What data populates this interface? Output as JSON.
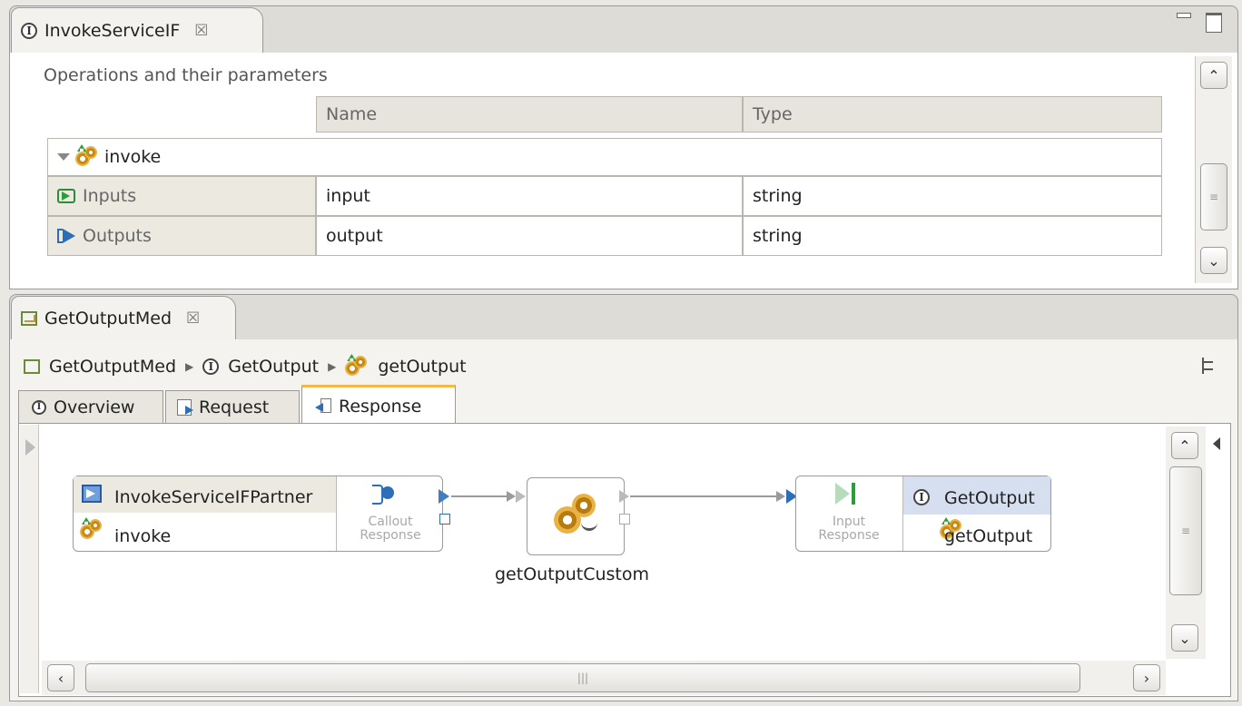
{
  "top_editor": {
    "tab_title": "InvokeServiceIF",
    "section_title": "Operations and their parameters",
    "columns": [
      "Name",
      "Type"
    ],
    "operation": "invoke",
    "rows": [
      {
        "label": "Inputs",
        "name": "input",
        "type": "string"
      },
      {
        "label": "Outputs",
        "name": "output",
        "type": "string"
      }
    ]
  },
  "bottom_editor": {
    "tab_title": "GetOutputMed",
    "breadcrumb": [
      "GetOutputMed",
      "GetOutput",
      "getOutput"
    ],
    "tabs": [
      "Overview",
      "Request",
      "Response"
    ],
    "active_tab": "Response",
    "flow": {
      "callout_partner": "InvokeServiceIFPartner",
      "callout_operation": "invoke",
      "callout_response_label": "Callout\nResponse",
      "custom_primitive": "getOutputCustom",
      "input_response_label": "Input\nResponse",
      "interface_name": "GetOutput",
      "interface_operation": "getOutput"
    }
  },
  "icons": {
    "interface": "interface-icon",
    "operation": "operation-icon",
    "mediation": "mediation-flow-icon"
  },
  "colors": {
    "selected_row": "#d5dff0",
    "active_tab_accent": "#f0b94a",
    "terminal_blue": "#2c6fb8"
  }
}
